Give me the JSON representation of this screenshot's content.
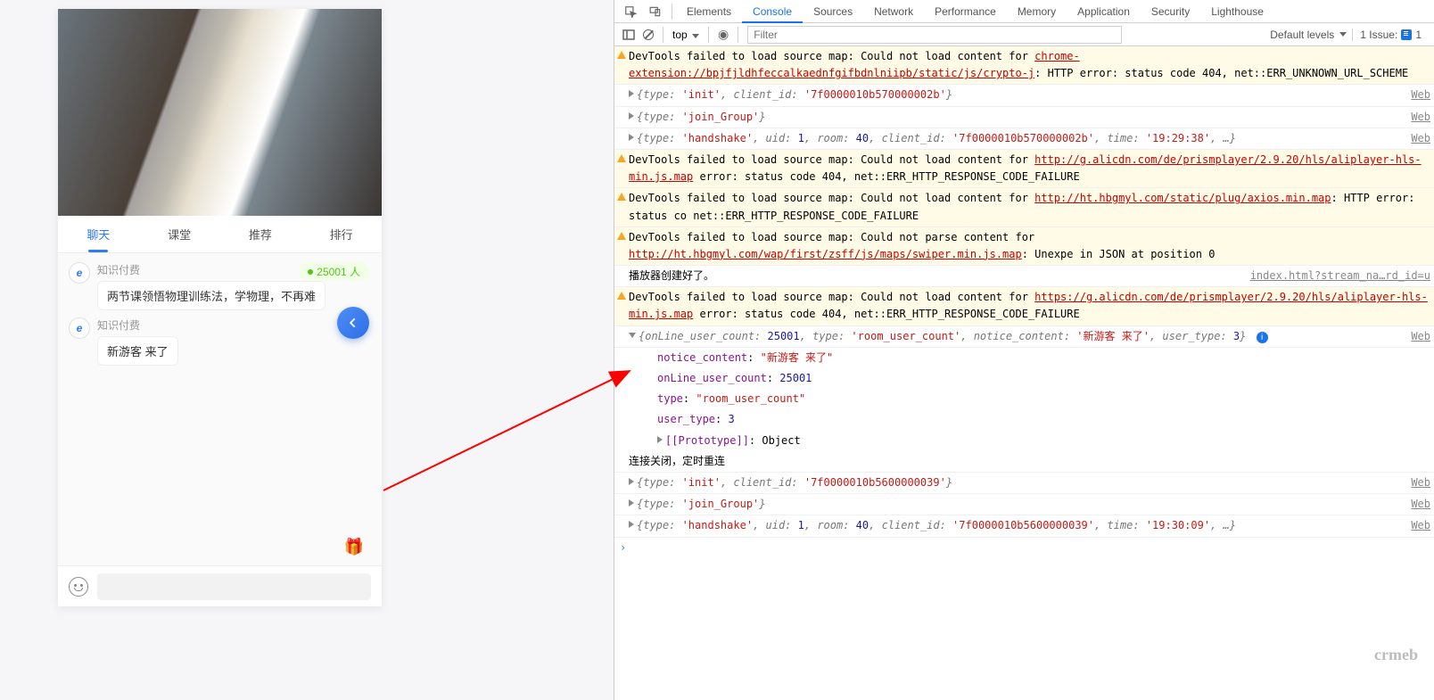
{
  "app": {
    "tabs": [
      "聊天",
      "课堂",
      "推荐",
      "排行"
    ],
    "active_tab": 0,
    "online_count": "25001 人",
    "messages": [
      {
        "name": "知识付费",
        "text": "两节课领悟物理训练法，学物理，不再难"
      },
      {
        "name": "知识付费",
        "text": "新游客 来了"
      }
    ],
    "input_placeholder": "",
    "gift": "🎁"
  },
  "devtools": {
    "panels": [
      "Elements",
      "Console",
      "Sources",
      "Network",
      "Performance",
      "Memory",
      "Application",
      "Security",
      "Lighthouse"
    ],
    "active_panel": 1,
    "toolbar": {
      "context": "top",
      "filter_placeholder": "Filter",
      "levels": "Default levels",
      "issues_label": "1 Issue:",
      "issues_count": "1"
    },
    "console": {
      "warn1": {
        "pre": "DevTools failed to load source map: Could not load content for ",
        "link": "chrome-extension://bpjfjldhfeccalkaednfgifbdnlniipb/static/js/crypto-j",
        "post": ": HTTP error: status code 404, net::ERR_UNKNOWN_URL_SCHEME"
      },
      "obj_init1": "{type: 'init', client_id: '7f0000010b570000002b'}",
      "obj_join1": "{type: 'join_Group'}",
      "obj_hand1": "{type: 'handshake', uid: 1, room: 40, client_id: '7f0000010b570000002b', time: '19:29:38', …}",
      "warn2": {
        "pre": "DevTools failed to load source map: Could not load content for ",
        "link": "http://g.alicdn.com/de/prismplayer/2.9.20/hls/aliplayer-hls-min.js.map",
        "post": " error: status code 404, net::ERR_HTTP_RESPONSE_CODE_FAILURE"
      },
      "warn3": {
        "pre": "DevTools failed to load source map: Could not load content for ",
        "link": "http://ht.hbgmyl.com/static/plug/axios.min.map",
        "post": ": HTTP error: status co net::ERR_HTTP_RESPONSE_CODE_FAILURE"
      },
      "warn4": {
        "pre": "DevTools failed to load source map: Could not parse content for ",
        "link": "http://ht.hbgmyl.com/wap/first/zsff/js/maps/swiper.min.js.map",
        "post": ": Unexpe in JSON at position 0"
      },
      "log_player": "播放器创建好了。",
      "log_player_src": "index.html?stream_na…rd_id=u",
      "warn5": {
        "pre": "DevTools failed to load source map: Could not load content for ",
        "link": "https://g.alicdn.com/de/prismplayer/2.9.20/hls/aliplayer-hls-min.js.map",
        "post": " error: status code 404, net::ERR_HTTP_RESPONSE_CODE_FAILURE"
      },
      "obj_expanded_head": "{onLine_user_count: 25001, type: 'room_user_count', notice_content: '新游客 来了', user_type: 3}",
      "obj_expanded": {
        "notice_content": "\"新游客 来了\"",
        "onLine_user_count": "25001",
        "type": "\"room_user_count\"",
        "user_type": "3",
        "proto": "Object"
      },
      "log_close": "连接关闭，定时重连",
      "obj_init2": "{type: 'init', client_id: '7f0000010b5600000039'}",
      "obj_join2": "{type: 'join_Group'}",
      "obj_hand2": "{type: 'handshake', uid: 1, room: 40, client_id: '7f0000010b5600000039', time: '19:30:09', …}",
      "src_web": "Web"
    }
  },
  "logo": "crmeb"
}
